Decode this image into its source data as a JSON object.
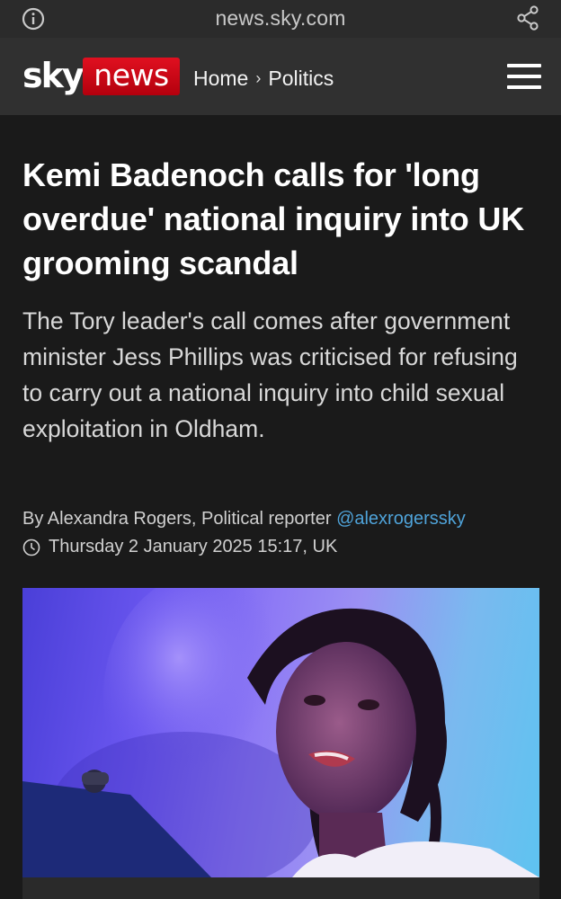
{
  "browser": {
    "domain": "news.sky.com",
    "info_icon": "info-icon",
    "share_icon": "share-icon"
  },
  "header": {
    "logo_sky": "sky",
    "logo_news": "news",
    "breadcrumb": [
      "Home",
      "Politics"
    ],
    "menu_icon": "hamburger-menu-icon",
    "colors": {
      "brand_red": "#d0021b",
      "header_bg": "#303030"
    }
  },
  "article": {
    "headline": "Kemi Badenoch calls for 'long overdue' national inquiry into UK grooming scandal",
    "standfirst": "The Tory leader's call comes after government minister Jess Phillips was criticised for refusing to carry out a national inquiry into child sexual exploitation in Oldham.",
    "byline_prefix": "By Alexandra Rogers, Political reporter",
    "byline_handle": "@alexrogerssky",
    "date": "Thursday 2 January 2025 15:17, UK",
    "clock_icon": "clock-icon",
    "colors": {
      "handle": "#4fa3d9",
      "background": "#1a1a1a"
    }
  }
}
